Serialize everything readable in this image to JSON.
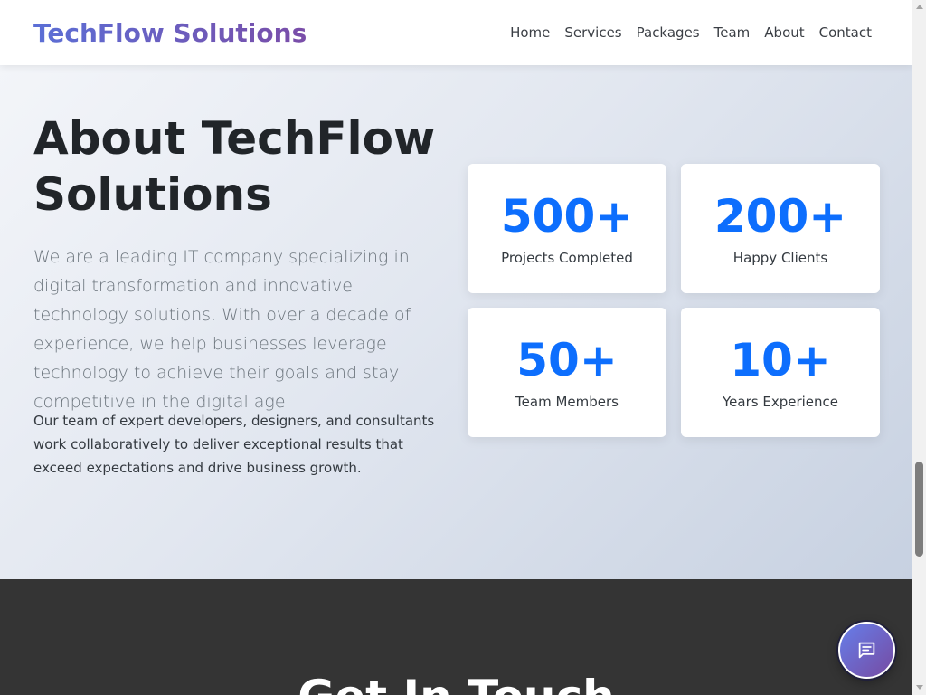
{
  "header": {
    "brand": "TechFlow Solutions",
    "nav": [
      {
        "label": "Home"
      },
      {
        "label": "Services"
      },
      {
        "label": "Packages"
      },
      {
        "label": "Team"
      },
      {
        "label": "About"
      },
      {
        "label": "Contact"
      }
    ]
  },
  "about": {
    "title": "About TechFlow Solutions",
    "lead": "We are a leading IT company specializing in digital transformation and innovative technology solutions. With over a decade of experience, we help businesses leverage technology to achieve their goals and stay competitive in the digital age.",
    "body": "Our team of expert developers, designers, and consultants work collaboratively to deliver exceptional results that exceed expectations and drive business growth.",
    "stats": [
      {
        "value": "500+",
        "label": "Projects Completed"
      },
      {
        "value": "200+",
        "label": "Happy Clients"
      },
      {
        "value": "50+",
        "label": "Team Members"
      },
      {
        "value": "10+",
        "label": "Years Experience"
      }
    ]
  },
  "contact": {
    "title": "Get In Touch"
  },
  "chat": {
    "icon": "chat-message-icon"
  },
  "colors": {
    "accent": "#0d6efd",
    "brand_gradient_start": "#667eea",
    "brand_gradient_end": "#764ba2",
    "contact_background": "#343434"
  }
}
